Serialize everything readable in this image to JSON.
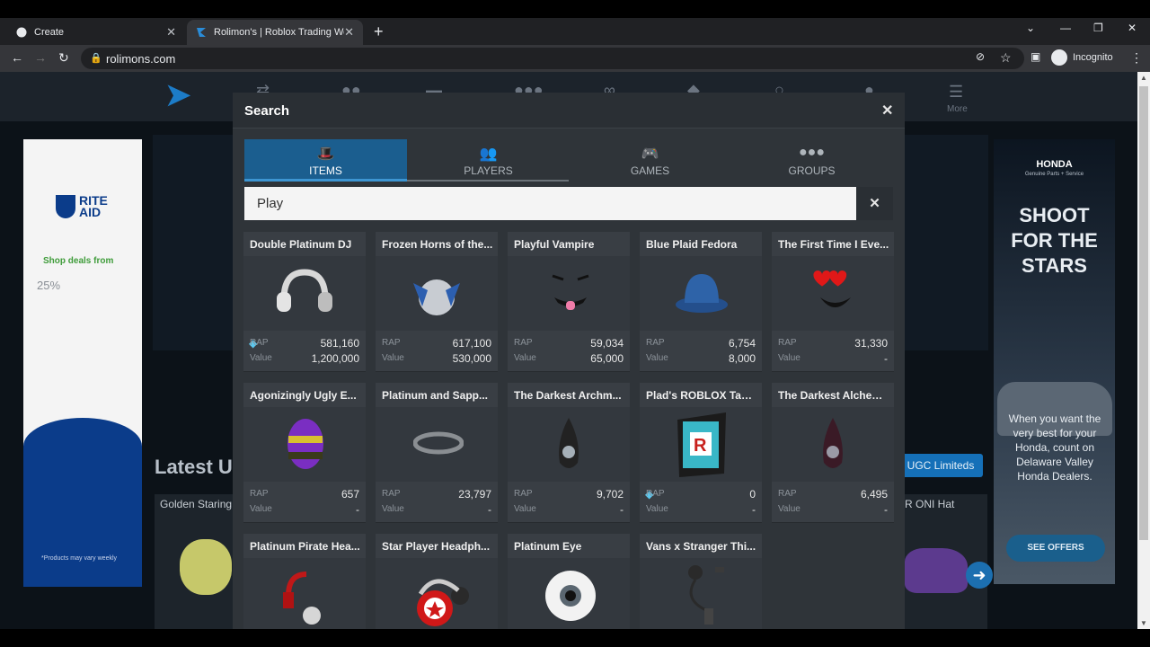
{
  "browser": {
    "tabs": [
      {
        "title": "Create",
        "active": false
      },
      {
        "title": "Rolimon's | Roblox Trading Webs",
        "active": true
      }
    ],
    "url": "rolimons.com",
    "profile_label": "Incognito"
  },
  "site": {
    "nav_more_label": "More",
    "latest_label": "Latest U",
    "ugc_label": "UGC Limiteds",
    "left_card_title": "Golden Staring",
    "right_card_title": "R ONI Hat"
  },
  "ads": {
    "left": {
      "brand_line1": "RITE",
      "brand_line2": "AID",
      "shop_text": "Shop deals from",
      "pct_text": "25%",
      "fine_print": "*Products may vary weekly"
    },
    "right": {
      "brand": "HONDA",
      "tagline": "Genuine Parts + Service",
      "headline_1": "SHOOT",
      "headline_2": "FOR THE",
      "headline_3": "STARS",
      "body": "When you want the very best for your Honda, count on Delaware Valley Honda Dealers.",
      "cta": "SEE OFFERS"
    }
  },
  "search": {
    "title": "Search",
    "tabs": [
      {
        "label": "ITEMS",
        "icon": "item-hat-icon"
      },
      {
        "label": "PLAYERS",
        "icon": "players-icon"
      },
      {
        "label": "GAMES",
        "icon": "gamepad-icon"
      },
      {
        "label": "GROUPS",
        "icon": "groups-icon"
      }
    ],
    "query": "Play",
    "stat_labels": {
      "rap": "RAP",
      "value": "Value"
    },
    "results": [
      {
        "name": "Double Platinum DJ",
        "rap": "581,160",
        "value": "1,200,000",
        "gem": true
      },
      {
        "name": "Frozen Horns of the...",
        "rap": "617,100",
        "value": "530,000",
        "gem": false
      },
      {
        "name": "Playful Vampire",
        "rap": "59,034",
        "value": "65,000",
        "gem": false
      },
      {
        "name": "Blue Plaid Fedora",
        "rap": "6,754",
        "value": "8,000",
        "gem": false
      },
      {
        "name": "The First Time I Eve...",
        "rap": "31,330",
        "value": "-",
        "gem": false
      },
      {
        "name": "Agonizingly Ugly E...",
        "rap": "657",
        "value": "-",
        "gem": false
      },
      {
        "name": "Platinum and Sapp...",
        "rap": "23,797",
        "value": "-",
        "gem": false
      },
      {
        "name": "The Darkest Archm...",
        "rap": "9,702",
        "value": "-",
        "gem": false
      },
      {
        "name": "Plad's ROBLOX Tablet",
        "rap": "0",
        "value": "-",
        "gem": true
      },
      {
        "name": "The Darkest Alchem...",
        "rap": "6,495",
        "value": "-",
        "gem": false
      },
      {
        "name": "Platinum Pirate Hea...",
        "rap": "",
        "value": "",
        "gem": false
      },
      {
        "name": "Star Player Headph...",
        "rap": "",
        "value": "",
        "gem": false
      },
      {
        "name": "Platinum Eye",
        "rap": "",
        "value": "",
        "gem": false
      },
      {
        "name": "Vans x Stranger Thi...",
        "rap": "",
        "value": "",
        "gem": false
      }
    ]
  },
  "colors": {
    "modal_bg": "#2f3439",
    "card_bg": "#393e44",
    "active_tab": "#1b5e8f",
    "gem": "#5bc8ef"
  }
}
